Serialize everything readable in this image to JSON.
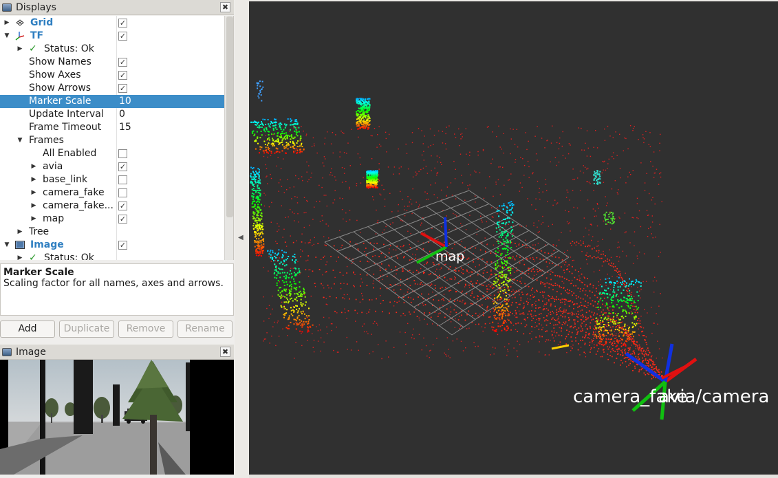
{
  "displays_panel": {
    "title": "Displays",
    "close_glyph": "✖",
    "rows": [
      {
        "id": "grid",
        "label": "Grid",
        "bold": true,
        "indent": 0,
        "arrow": "right",
        "icon": "grid-icon",
        "checked": true
      },
      {
        "id": "tf",
        "label": "TF",
        "bold": true,
        "indent": 0,
        "arrow": "down",
        "icon": "tf-axes-icon",
        "checked": true
      },
      {
        "id": "tf-status",
        "label": "Status: Ok",
        "indent": 1,
        "arrow": "right",
        "icon": "check-icon"
      },
      {
        "id": "show-names",
        "label": "Show Names",
        "indent": 1,
        "checked": true
      },
      {
        "id": "show-axes",
        "label": "Show Axes",
        "indent": 1,
        "checked": true
      },
      {
        "id": "show-arrows",
        "label": "Show Arrows",
        "indent": 1,
        "checked": true
      },
      {
        "id": "marker-scale",
        "label": "Marker Scale",
        "indent": 1,
        "value": "10",
        "selected": true
      },
      {
        "id": "update-interval",
        "label": "Update Interval",
        "indent": 1,
        "value": "0"
      },
      {
        "id": "frame-timeout",
        "label": "Frame Timeout",
        "indent": 1,
        "value": "15"
      },
      {
        "id": "frames",
        "label": "Frames",
        "indent": 1,
        "arrow": "down"
      },
      {
        "id": "all-enabled",
        "label": "All Enabled",
        "indent": 2,
        "checked": false
      },
      {
        "id": "frame-avia",
        "label": "avia",
        "indent": 2,
        "arrow": "right",
        "checked": true
      },
      {
        "id": "frame-base-link",
        "label": "base_link",
        "indent": 2,
        "arrow": "right",
        "checked": false
      },
      {
        "id": "frame-camera-fake",
        "label": "camera_fake",
        "indent": 2,
        "arrow": "right",
        "checked": false
      },
      {
        "id": "frame-camera-fake2",
        "label": "camera_fake...",
        "indent": 2,
        "arrow": "right",
        "checked": true
      },
      {
        "id": "frame-map",
        "label": "map",
        "indent": 2,
        "arrow": "right",
        "checked": true
      },
      {
        "id": "tree",
        "label": "Tree",
        "indent": 1,
        "arrow": "right"
      },
      {
        "id": "image",
        "label": "Image",
        "bold": true,
        "indent": 0,
        "arrow": "down",
        "icon": "image-icon",
        "checked": true
      },
      {
        "id": "image-status",
        "label": "Status: Ok",
        "indent": 1,
        "arrow": "right",
        "icon": "check-icon"
      }
    ]
  },
  "description": {
    "title": "Marker Scale",
    "text": "Scaling factor for all names, axes and arrows."
  },
  "buttons": {
    "add": "Add",
    "duplicate": "Duplicate",
    "remove": "Remove",
    "rename": "Rename"
  },
  "image_panel": {
    "title": "Image",
    "close_glyph": "✖"
  },
  "view3d": {
    "map_label": "map",
    "camera_label": "camera_fake",
    "avia_label": "avia/camera"
  },
  "splitter": {
    "collapse_glyph": "◀"
  },
  "colors": {
    "selection": "#3c8dc8",
    "display_name": "#2f7fc1",
    "viewport_bg": "#303030",
    "axis_x": "#e01010",
    "axis_y": "#10c010",
    "axis_z": "#1030e0"
  }
}
